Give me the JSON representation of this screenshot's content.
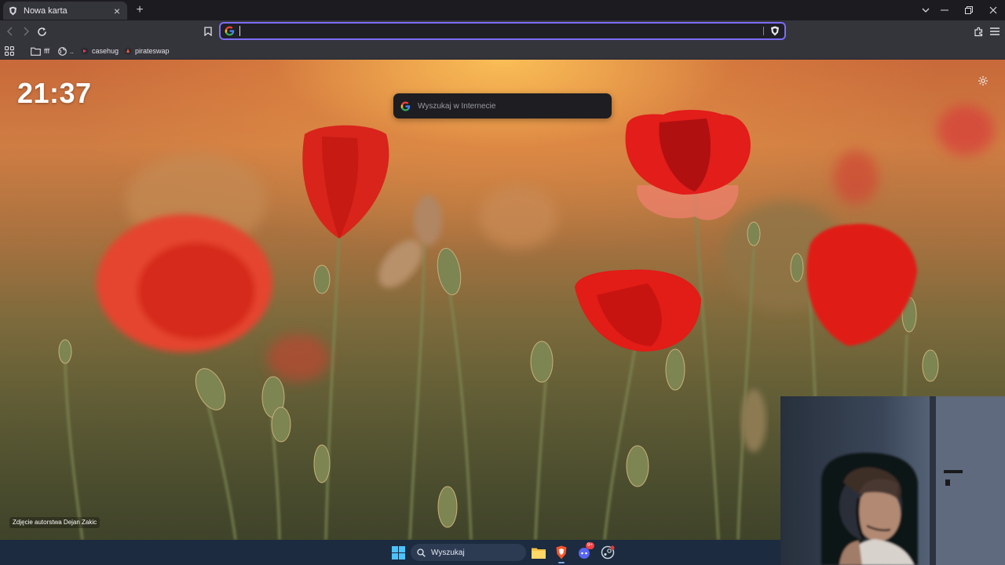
{
  "browser": {
    "tab": {
      "title": "Nowa karta"
    },
    "urlbar": {
      "value": "",
      "placeholder": ""
    },
    "bookmarks": [
      {
        "label": "fff",
        "icon": "folder-icon"
      },
      {
        "label": "..",
        "icon": "globe-icon"
      },
      {
        "label": "casehug",
        "icon": "casehug-icon"
      },
      {
        "label": "pirateswap",
        "icon": "pirateswap-icon"
      }
    ],
    "accent": "#7b6ef6"
  },
  "newtab": {
    "clock": "21:37",
    "search_placeholder": "Wyszukaj w Internecie",
    "photo_credit": "Zdjęcie autorstwa Dejan Zakic"
  },
  "taskbar": {
    "search_label": "Wyszukaj",
    "discord_badge": "9+"
  }
}
